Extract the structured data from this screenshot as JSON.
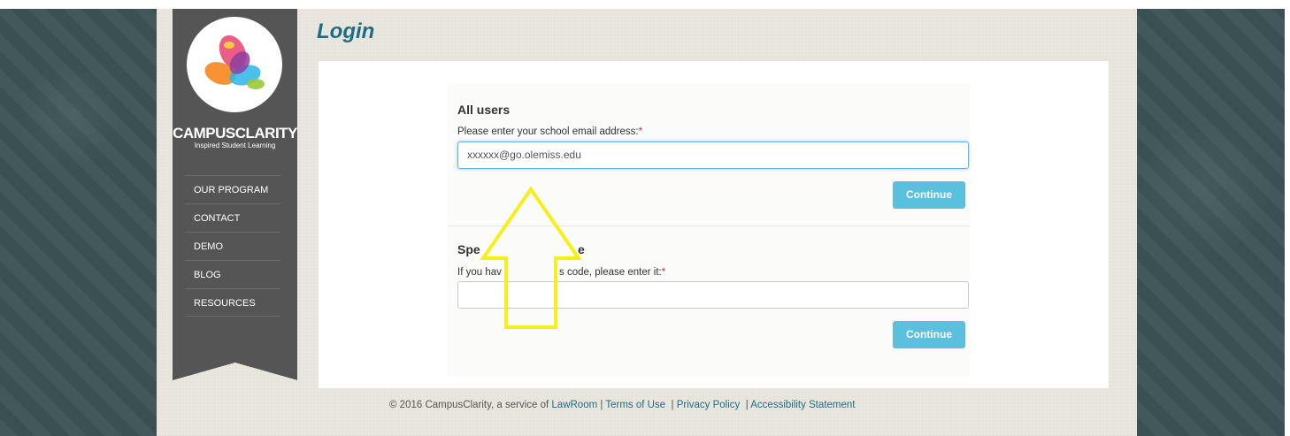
{
  "page": {
    "title": "Login"
  },
  "brand": {
    "name": "CAMPUSCLARITY",
    "tagline": "Inspired Student Learning"
  },
  "nav": {
    "items": [
      {
        "label": "OUR PROGRAM"
      },
      {
        "label": "CONTACT"
      },
      {
        "label": "DEMO"
      },
      {
        "label": "BLOG"
      },
      {
        "label": "RESOURCES"
      }
    ]
  },
  "all_users": {
    "heading": "All users",
    "email_label": "Please enter your school email address:",
    "email_value": "xxxxxx@go.olemiss.edu",
    "continue_label": "Continue"
  },
  "special": {
    "heading_visible_start": "Spe",
    "heading_visible_end": "e",
    "code_label_start": "If you hav",
    "code_label_end": "s code, please enter it:",
    "code_value": "",
    "continue_label": "Continue"
  },
  "required_marker": "*",
  "footer": {
    "copyright": "© 2016 CampusClarity, a service of",
    "lawroom": "LawRoom",
    "terms": "Terms of Use",
    "privacy": "Privacy Policy",
    "accessibility": "Accessibility Statement"
  },
  "colors": {
    "accent": "#1e6e83",
    "button": "#5bc0de",
    "sidebar": "#555555",
    "arrow": "#f5ef1a"
  }
}
